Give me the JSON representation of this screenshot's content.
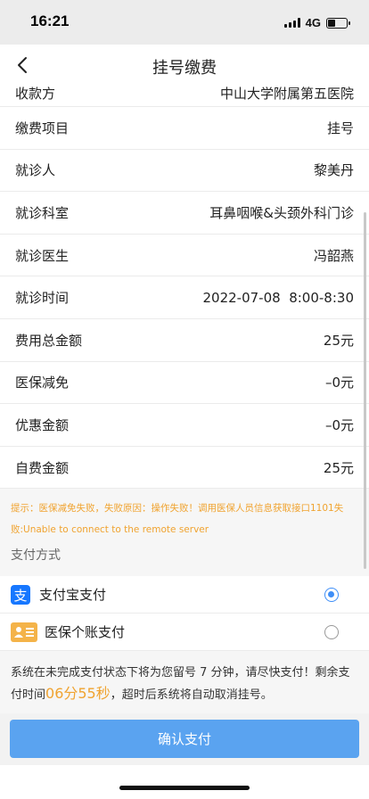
{
  "status_bar": {
    "time": "16:21",
    "network": "4G"
  },
  "nav": {
    "title": "挂号缴费"
  },
  "rows": [
    {
      "label": "收款方",
      "value": "中山大学附属第五医院"
    },
    {
      "label": "缴费项目",
      "value": "挂号"
    },
    {
      "label": "就诊人",
      "value": "黎美丹"
    },
    {
      "label": "就诊科室",
      "value": "耳鼻咽喉&头颈外科门诊"
    },
    {
      "label": "就诊医生",
      "value": "冯韶燕"
    },
    {
      "label": "就诊时间",
      "value": "2022-07-08  8:00-8:30"
    },
    {
      "label": "费用总金额",
      "value": "25元"
    },
    {
      "label": "医保减免",
      "value": "–0元"
    },
    {
      "label": "优惠金额",
      "value": "–0元"
    },
    {
      "label": "自费金额",
      "value": "25元"
    }
  ],
  "notice": "提示：医保减免失败，失败原因：操作失败！调用医保人员信息获取接口1101失败:Unable to connect to the remote server",
  "payment": {
    "section_title": "支付方式",
    "methods": [
      {
        "label": "支付宝支付",
        "selected": true,
        "icon": "alipay-icon"
      },
      {
        "label": "医保个账支付",
        "selected": false,
        "icon": "medical-card-icon"
      }
    ]
  },
  "tip": {
    "part1": "系统在未完成支付状态下将为您留号 7 分钟，请尽快支付！剩余支付时间",
    "countdown": "06分55秒",
    "part2": "，超时后系统将自动取消挂号。"
  },
  "confirm_label": "确认支付",
  "colors": {
    "primary": "#5aa3f0",
    "accent": "#f0a330",
    "alipay": "#1677ff",
    "card": "#f4b349"
  }
}
